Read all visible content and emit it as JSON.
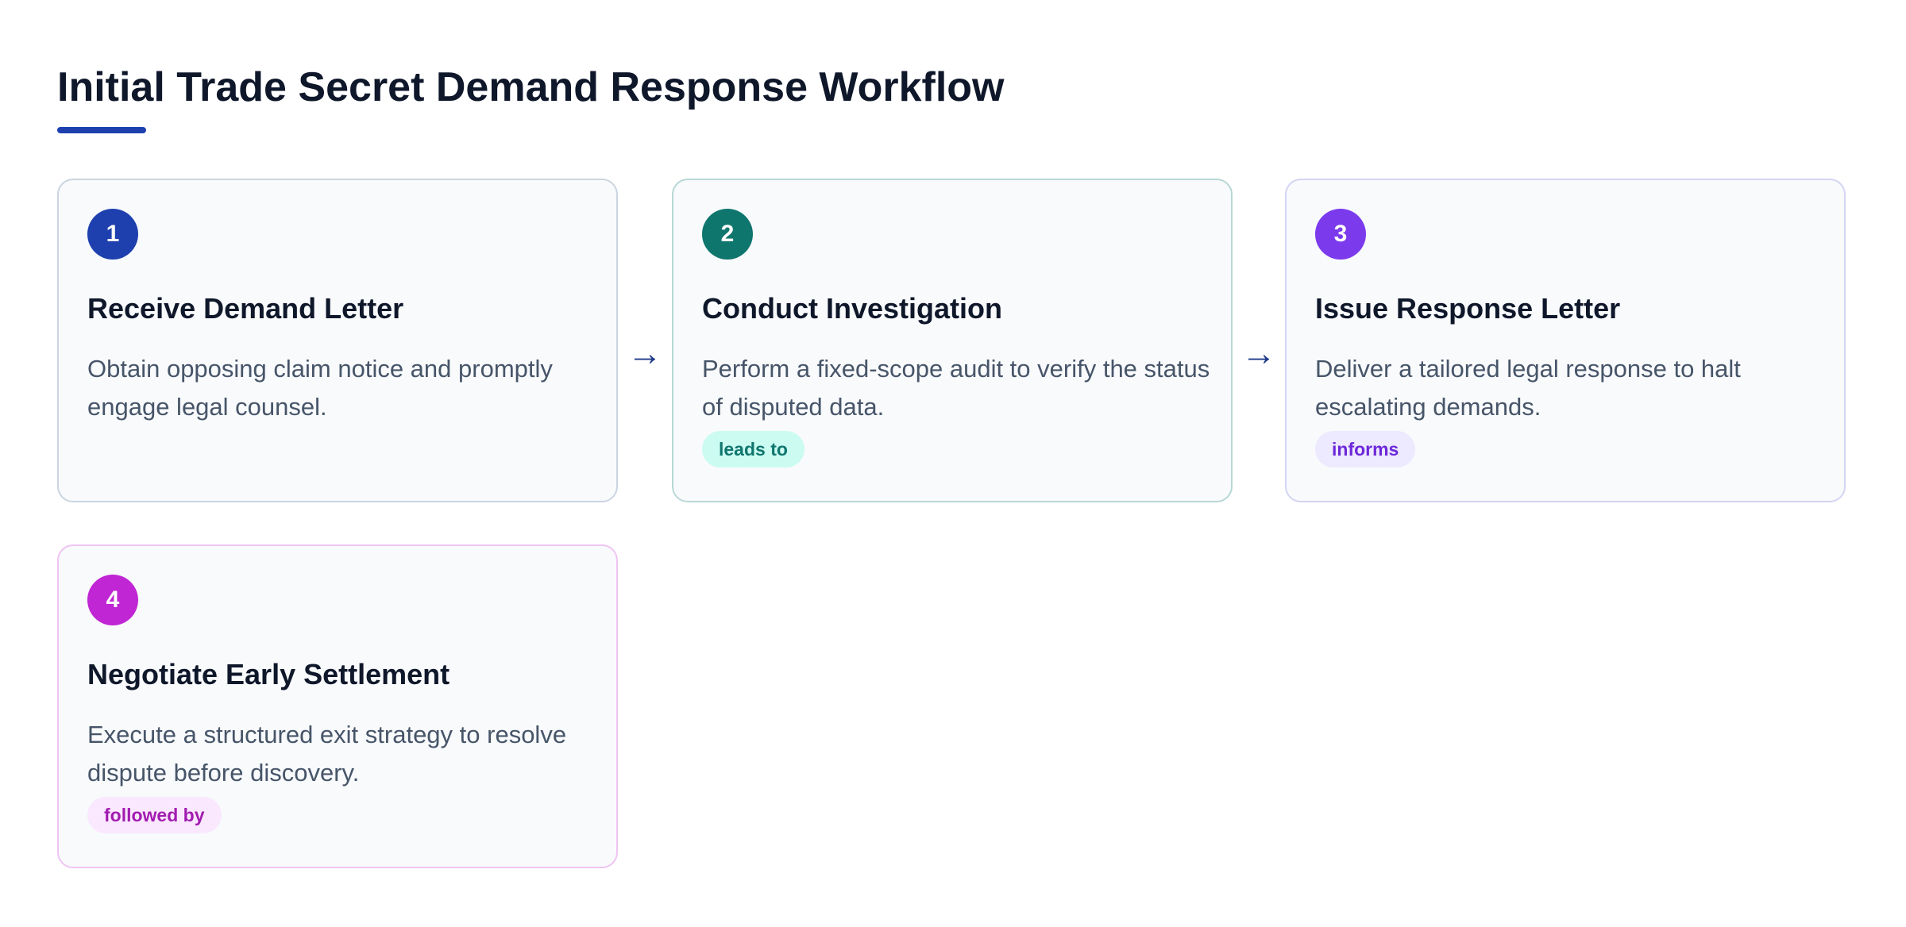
{
  "title": "Initial Trade Secret Demand Response Workflow",
  "colors": {
    "title": "#0f172a",
    "accent_underline": "#1e40af",
    "card_background": "#f8fafc",
    "description_text": "#475569",
    "arrow": "#1e3a8a"
  },
  "connectors": [
    "→",
    "→"
  ],
  "steps": [
    {
      "number": "1",
      "title": "Receive Demand Letter",
      "description": "Obtain opposing claim notice and promptly engage legal counsel.",
      "tag": "",
      "colors": {
        "badge": "#1e40af",
        "border": "#cbd5e1",
        "tag_bg": "",
        "tag_text": ""
      }
    },
    {
      "number": "2",
      "title": "Conduct Investigation",
      "description": "Perform a fixed-scope audit to verify the status of disputed data.",
      "tag": "leads to",
      "colors": {
        "badge": "#0f766e",
        "border": "#b7d8d4",
        "tag_bg": "#ccfbf1",
        "tag_text": "#0f766e"
      }
    },
    {
      "number": "3",
      "title": "Issue Response Letter",
      "description": "Deliver a tailored legal response to halt escalating demands.",
      "tag": "informs",
      "colors": {
        "badge": "#7c3aed",
        "border": "#d4d4f4",
        "tag_bg": "#ede9fe",
        "tag_text": "#6d28d9"
      }
    },
    {
      "number": "4",
      "title": "Negotiate Early Settlement",
      "description": "Execute a structured exit strategy to resolve dispute before discovery.",
      "tag": "followed by",
      "colors": {
        "badge": "#c026d3",
        "border": "#f0c4f3",
        "tag_bg": "#fae8ff",
        "tag_text": "#a21caf"
      }
    }
  ]
}
